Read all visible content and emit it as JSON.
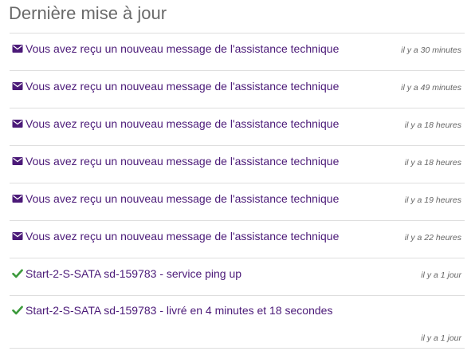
{
  "panel": {
    "title": "Dernière mise à jour"
  },
  "items": [
    {
      "icon": "envelope-icon",
      "text": "Vous avez reçu un nouveau message de l'assistance technique",
      "time": "il y a 30 minutes"
    },
    {
      "icon": "envelope-icon",
      "text": "Vous avez reçu un nouveau message de l'assistance technique",
      "time": "il y a 49 minutes"
    },
    {
      "icon": "envelope-icon",
      "text": "Vous avez reçu un nouveau message de l'assistance technique",
      "time": "il y a 18 heures"
    },
    {
      "icon": "envelope-icon",
      "text": "Vous avez reçu un nouveau message de l'assistance technique",
      "time": "il y a 18 heures"
    },
    {
      "icon": "envelope-icon",
      "text": "Vous avez reçu un nouveau message de l'assistance technique",
      "time": "il y a 19 heures"
    },
    {
      "icon": "envelope-icon",
      "text": "Vous avez reçu un nouveau message de l'assistance technique",
      "time": "il y a 22 heures"
    },
    {
      "icon": "check-icon",
      "text": "Start-2-S-SATA sd-159783 - service ping up",
      "time": "il y a 1 jour"
    },
    {
      "icon": "check-icon",
      "text": "Start-2-S-SATA sd-159783 - livré en 4 minutes et 18 secondes",
      "time": "il y a 1 jour"
    }
  ],
  "colors": {
    "link": "#4b1a78",
    "envelope_icon": "#4b1a78",
    "check_icon": "#3c9a3c",
    "title": "#6a6a6a",
    "timestamp": "#666666",
    "divider": "#dedede"
  }
}
